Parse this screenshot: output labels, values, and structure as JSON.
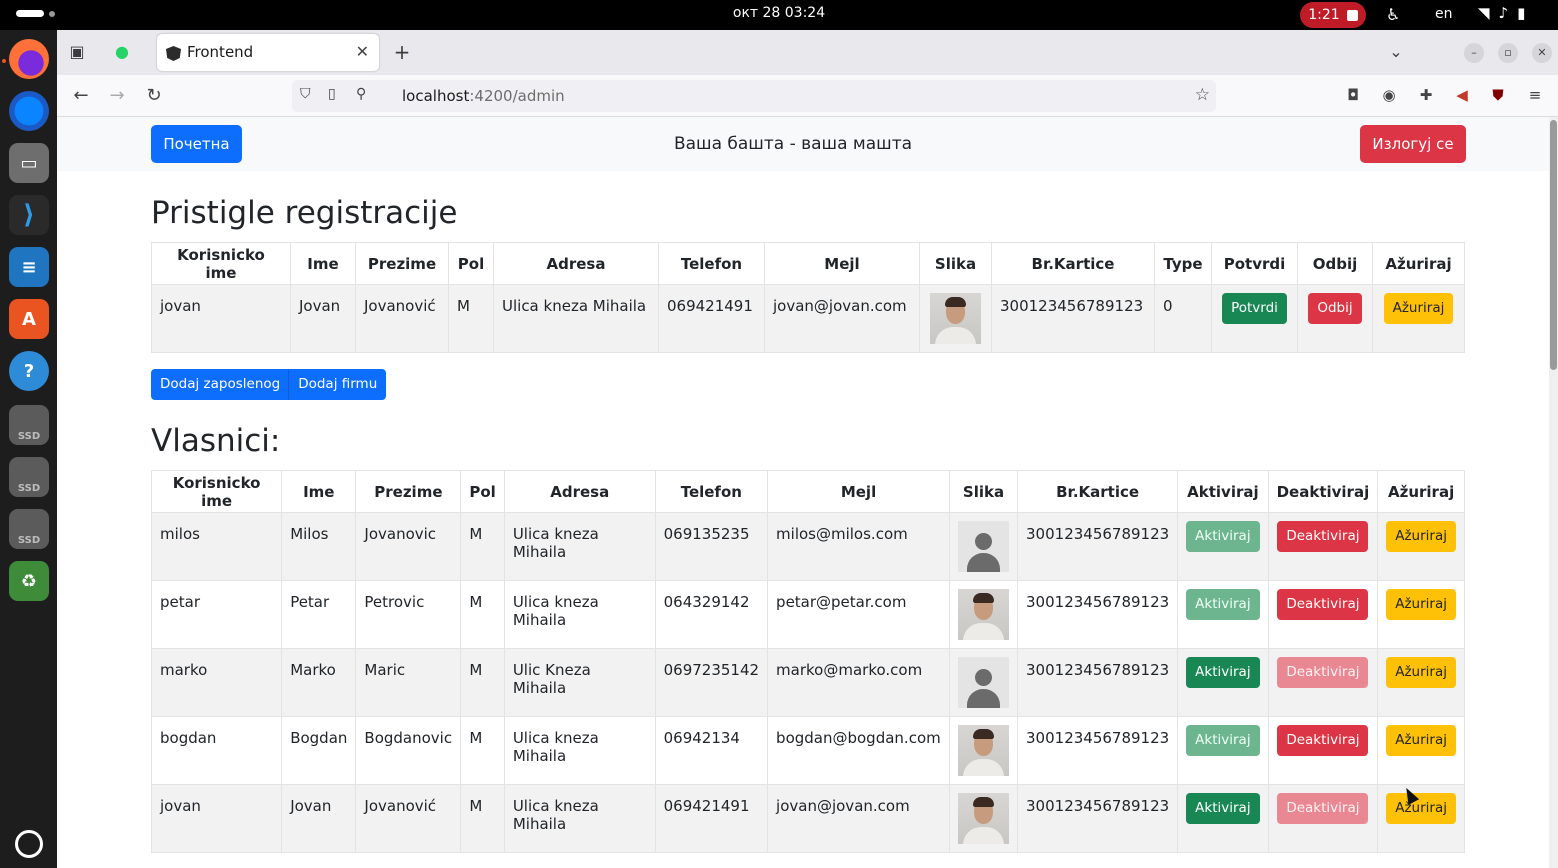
{
  "os": {
    "clock": "окт 28  03:24",
    "recording_time": "1:21",
    "language": "en",
    "dock_ssd_label": "SSD",
    "dock_apps": [
      "firefox-icon",
      "thunderbird-icon",
      "files-icon",
      "vscode-icon",
      "writer-icon",
      "app-center-icon",
      "help-icon",
      "ssd-drive-icon",
      "ssd-drive-icon",
      "ssd-drive-icon",
      "trash-icon"
    ]
  },
  "browser": {
    "tab_title": "Frontend",
    "url_host": "localhost",
    "url_path": ":4200/admin"
  },
  "app": {
    "home_button": "Почетна",
    "brand": "Ваша башта - ваша машта",
    "logout_button": "Излогуј се"
  },
  "registrations": {
    "heading": "Pristigle registracije",
    "columns": [
      "Korisnicko ime",
      "Ime",
      "Prezime",
      "Pol",
      "Adresa",
      "Telefon",
      "Mejl",
      "Slika",
      "Br.Kartice",
      "Type",
      "Potvrdi",
      "Odbij",
      "Ažuriraj"
    ],
    "rows": [
      {
        "username": "jovan",
        "first": "Jovan",
        "last": "Jovanović",
        "gender": "M",
        "address": "Ulica kneza Mihaila",
        "phone": "069421491",
        "email": "jovan@jovan.com",
        "image": "photo",
        "card": "300123456789123",
        "type": "0",
        "confirm": "Potvrdi",
        "reject": "Odbij",
        "update": "Ažuriraj"
      }
    ]
  },
  "actions": {
    "add_employee": "Dodaj zaposlenog",
    "add_company": "Dodaj firmu"
  },
  "owners": {
    "heading": "Vlasnici:",
    "columns": [
      "Korisnicko ime",
      "Ime",
      "Prezime",
      "Pol",
      "Adresa",
      "Telefon",
      "Mejl",
      "Slika",
      "Br.Kartice",
      "Aktiviraj",
      "Deaktiviraj",
      "Ažuriraj"
    ],
    "rows": [
      {
        "username": "milos",
        "first": "Milos",
        "last": "Jovanovic",
        "gender": "M",
        "address": "Ulica kneza Mihaila",
        "phone": "069135235",
        "email": "milos@milos.com",
        "image": "blank",
        "card": "300123456789123",
        "activate": "Aktiviraj",
        "deactivate": "Deaktiviraj",
        "update": "Ažuriraj",
        "active": true
      },
      {
        "username": "petar",
        "first": "Petar",
        "last": "Petrovic",
        "gender": "M",
        "address": "Ulica kneza Mihaila",
        "phone": "064329142",
        "email": "petar@petar.com",
        "image": "photo",
        "card": "300123456789123",
        "activate": "Aktiviraj",
        "deactivate": "Deaktiviraj",
        "update": "Ažuriraj",
        "active": true
      },
      {
        "username": "marko",
        "first": "Marko",
        "last": "Maric",
        "gender": "M",
        "address": "Ulic Kneza Mihaila",
        "phone": "0697235142",
        "email": "marko@marko.com",
        "image": "blank",
        "card": "300123456789123",
        "activate": "Aktiviraj",
        "deactivate": "Deaktiviraj",
        "update": "Ažuriraj",
        "active": false
      },
      {
        "username": "bogdan",
        "first": "Bogdan",
        "last": "Bogdanovic",
        "gender": "M",
        "address": "Ulica kneza Mihaila",
        "phone": "06942134",
        "email": "bogdan@bogdan.com",
        "image": "photo",
        "card": "300123456789123",
        "activate": "Aktiviraj",
        "deactivate": "Deaktiviraj",
        "update": "Ažuriraj",
        "active": true
      },
      {
        "username": "jovan",
        "first": "Jovan",
        "last": "Jovanović",
        "gender": "M",
        "address": "Ulica kneza Mihaila",
        "phone": "069421491",
        "email": "jovan@jovan.com",
        "image": "photo",
        "card": "300123456789123",
        "activate": "Aktiviraj",
        "deactivate": "Deaktiviraj",
        "update": "Ažuriraj",
        "active": false
      }
    ]
  },
  "colors": {
    "primary": "#0d6efd",
    "danger": "#dc3545",
    "success": "#198754",
    "warning": "#ffc107",
    "recording": "#c01c28"
  }
}
